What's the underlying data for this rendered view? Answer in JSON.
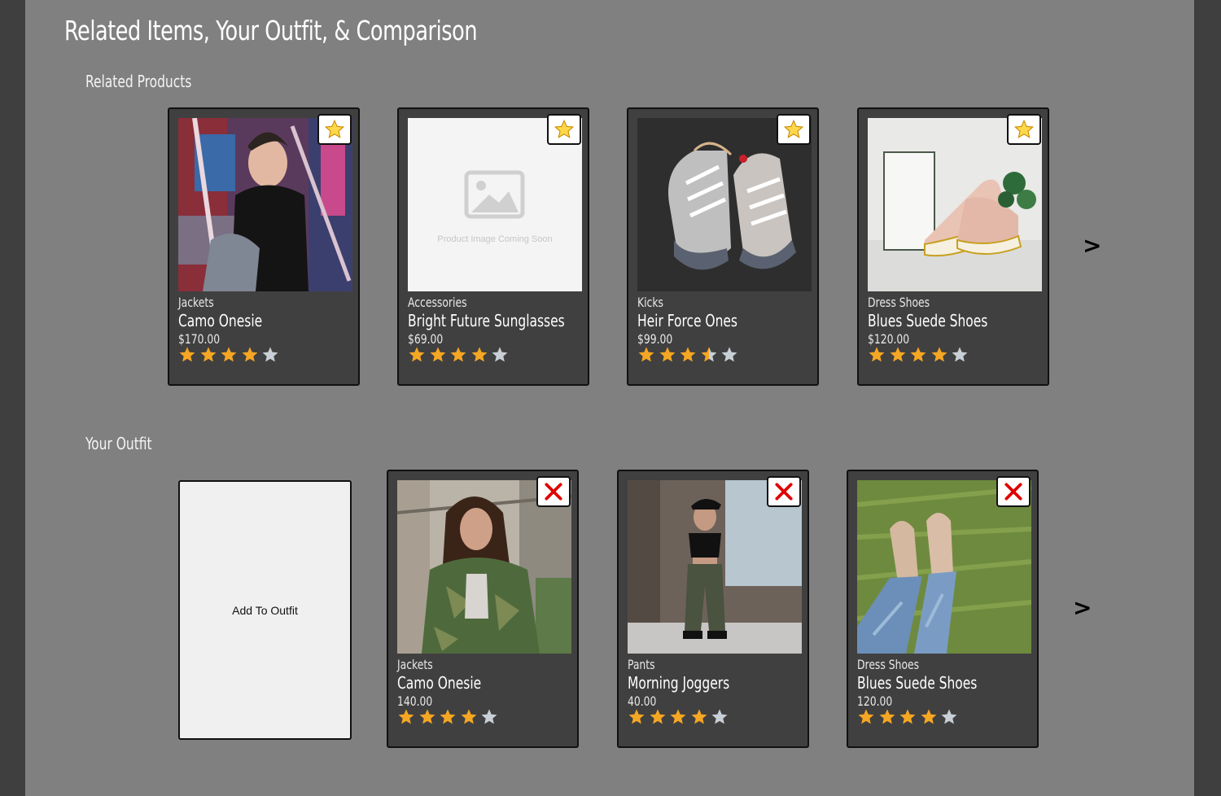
{
  "page_title": "Related Items, Your Outfit, & Comparison",
  "related": {
    "title": "Related Products",
    "next": ">",
    "cards": [
      {
        "category": "Jackets",
        "name": "Camo Onesie",
        "price": "$170.00",
        "rating": 4,
        "image": "graffiti-man-photo"
      },
      {
        "category": "Accessories",
        "name": "Bright Future Sunglasses",
        "price": "$69.00",
        "rating": 4,
        "image": "placeholder",
        "placeholder_text": "Product Image Coming Soon"
      },
      {
        "category": "Kicks",
        "name": "Heir Force Ones",
        "price": "$99.00",
        "rating": 3.5,
        "image": "sneakers-photo"
      },
      {
        "category": "Dress Shoes",
        "name": "Blues Suede Shoes",
        "price": "$120.00",
        "rating": 4,
        "image": "suede-shoes-photo"
      }
    ]
  },
  "outfit": {
    "title": "Your Outfit",
    "add_label": "Add To Outfit",
    "next": ">",
    "cards": [
      {
        "category": "Jackets",
        "name": "Camo Onesie",
        "price": "140.00",
        "rating": 4,
        "image": "camo-jacket-woman-photo"
      },
      {
        "category": "Pants",
        "name": "Morning Joggers",
        "price": "40.00",
        "rating": 4,
        "image": "joggers-woman-photo"
      },
      {
        "category": "Dress Shoes",
        "name": "Blues Suede Shoes",
        "price": "120.00",
        "rating": 4,
        "image": "boots-on-grass-photo"
      }
    ]
  },
  "colors": {
    "star_filled": "#f5a623",
    "star_empty": "#c9cfd6",
    "remove_x": "#e00000",
    "card_bg": "#404040",
    "page_bg": "#808080"
  },
  "icons": {
    "favorite": "star-icon",
    "remove": "close-x-icon",
    "next": "chevron-right-icon"
  }
}
